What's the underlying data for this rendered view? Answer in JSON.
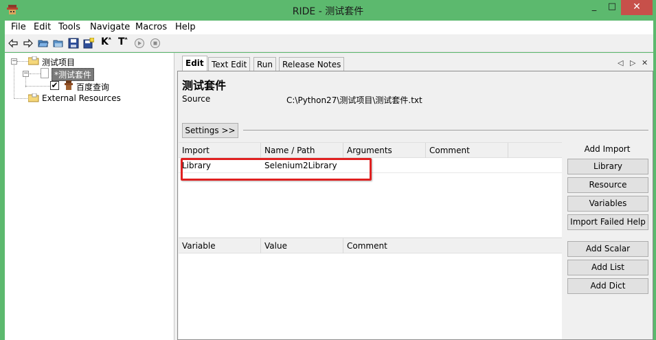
{
  "window": {
    "title": "RIDE - 测试套件",
    "min_glyph": "_",
    "max_glyph": "□",
    "close_glyph": "✕"
  },
  "menu": [
    "File",
    "Edit",
    "Tools",
    "Navigate",
    "Macros",
    "Help"
  ],
  "toolbar": {
    "icons": [
      "back-arrow-icon",
      "forward-arrow-icon",
      "open-folder-icon",
      "open-directory-icon",
      "save-icon",
      "save-all-icon",
      "search-keyword-icon",
      "search-test-icon",
      "run-icon",
      "stop-icon"
    ],
    "k_label": "K",
    "t_label": "T"
  },
  "tree": {
    "project": "测试项目",
    "suite": "*测试套件",
    "testcase": "百度查询",
    "external": "External Resources",
    "checked_glyph": "✔"
  },
  "tabs": [
    "Edit",
    "Text Edit",
    "Run",
    "Release Notes"
  ],
  "tab_controls": [
    "◁",
    "▷",
    "✕"
  ],
  "editor": {
    "suite_name": "测试套件",
    "source_label": "Source",
    "source_path": "C:\\Python27\\测试项目\\测试套件.txt",
    "settings_button": "Settings >>"
  },
  "imports": {
    "columns": [
      "Import",
      "Name / Path",
      "Arguments",
      "Comment"
    ],
    "rows": [
      {
        "type": "Library",
        "name": "Selenium2Library"
      }
    ]
  },
  "variables": {
    "columns": [
      "Variable",
      "Value",
      "Comment"
    ]
  },
  "side": {
    "add_import_heading": "Add Import",
    "import_buttons": [
      "Library",
      "Resource",
      "Variables",
      "Import Failed Help"
    ],
    "variable_buttons": [
      "Add Scalar",
      "Add List",
      "Add Dict"
    ]
  },
  "colors": {
    "titlebar": "#5cb96e",
    "close_button": "#c7504a",
    "highlight": "#e02020",
    "selection": "#7a7a7a"
  }
}
